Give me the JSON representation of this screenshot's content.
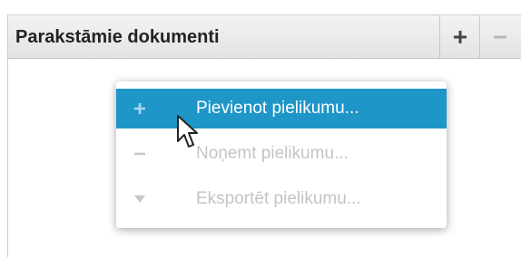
{
  "panel": {
    "title": "Parakstāmie dokumenti",
    "add_icon": "plus-icon",
    "remove_icon": "minus-icon"
  },
  "menu": {
    "items": [
      {
        "label": "Pievienot pielikumu...",
        "icon": "plus-icon",
        "state": "highlighted"
      },
      {
        "label": "Noņemt pielikumu...",
        "icon": "minus-icon",
        "state": "disabled"
      },
      {
        "label": "Eksportēt pielikumu...",
        "icon": "triangle-down-icon",
        "state": "disabled"
      }
    ]
  },
  "colors": {
    "highlight": "#1f96c8",
    "disabled_text": "#c4c4c4",
    "header_text": "#222222"
  }
}
